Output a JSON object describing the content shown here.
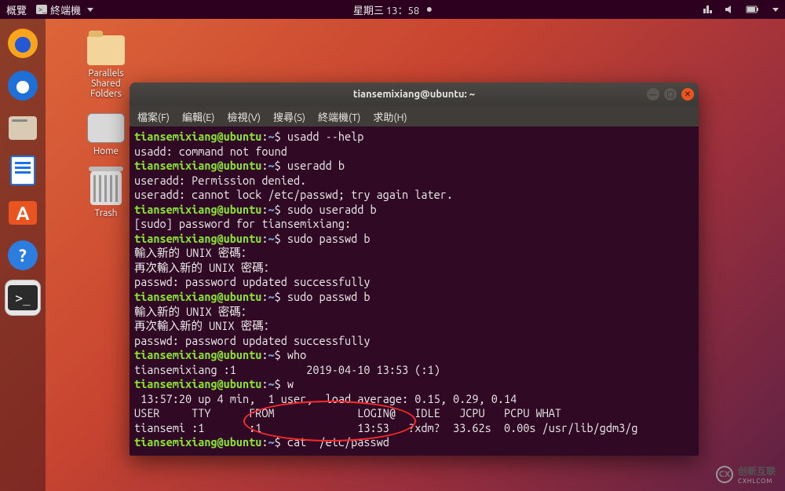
{
  "topbar": {
    "activities": "概覽",
    "app_menu": "終端機",
    "clock": "星期三 13：58"
  },
  "desktop": {
    "icons": [
      {
        "name": "parallels-shared-folders",
        "label": "Parallels\nShared\nFolders"
      },
      {
        "name": "home",
        "label": "Home"
      },
      {
        "name": "trash",
        "label": "Trash"
      }
    ]
  },
  "dock": {
    "items": [
      "firefox",
      "thunderbird",
      "files",
      "writer",
      "software",
      "help",
      "terminal"
    ]
  },
  "terminal": {
    "title": "tiansemixiang@ubuntu: ~",
    "menu": [
      "檔案(F)",
      "編輯(E)",
      "檢視(V)",
      "搜尋(S)",
      "終端機(T)",
      "求助(H)"
    ],
    "prompt_user": "tiansemixiang@ubuntu",
    "prompt_path": "~",
    "lines": [
      {
        "t": "prompt",
        "cmd": "usadd --help"
      },
      {
        "t": "out",
        "text": "usadd: command not found"
      },
      {
        "t": "prompt",
        "cmd": "useradd b"
      },
      {
        "t": "out",
        "text": "useradd: Permission denied."
      },
      {
        "t": "out",
        "text": "useradd: cannot lock /etc/passwd; try again later."
      },
      {
        "t": "prompt",
        "cmd": "sudo useradd b"
      },
      {
        "t": "out",
        "text": "[sudo] password for tiansemixiang:"
      },
      {
        "t": "prompt",
        "cmd": "sudo passwd b"
      },
      {
        "t": "out",
        "text": "輸入新的 UNIX 密碼："
      },
      {
        "t": "out",
        "text": "再次輸入新的 UNIX 密碼："
      },
      {
        "t": "out",
        "text": "passwd: password updated successfully"
      },
      {
        "t": "prompt",
        "cmd": "sudo passwd b"
      },
      {
        "t": "out",
        "text": "輸入新的 UNIX 密碼："
      },
      {
        "t": "out",
        "text": "再次輸入新的 UNIX 密碼："
      },
      {
        "t": "out",
        "text": "passwd: password updated successfully"
      },
      {
        "t": "prompt",
        "cmd": "who"
      },
      {
        "t": "out",
        "text": "tiansemixiang :1           2019-04-10 13:53 (:1)"
      },
      {
        "t": "prompt",
        "cmd": "w"
      },
      {
        "t": "out",
        "text": " 13:57:20 up 4 min,  1 user,  load average: 0.15, 0.29, 0.14"
      },
      {
        "t": "out",
        "text": "USER     TTY      FROM             LOGIN@   IDLE   JCPU   PCPU WHAT"
      },
      {
        "t": "out",
        "text": "tiansemi :1       :1               13:53   ?xdm?  33.62s  0.00s /usr/lib/gdm3/g"
      },
      {
        "t": "prompt",
        "cmd": "cat  /etc/passwd"
      }
    ]
  },
  "watermark": {
    "brand": "创新互联",
    "sub": "CXHLCOM"
  }
}
